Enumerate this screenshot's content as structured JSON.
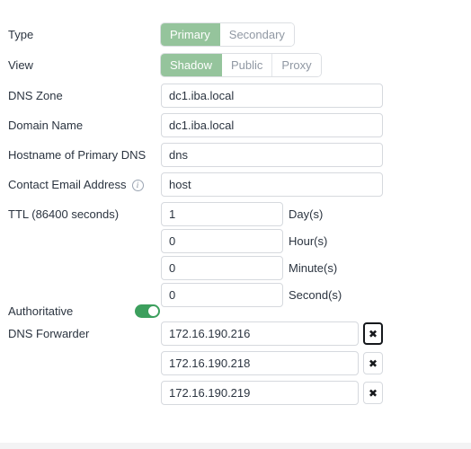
{
  "form": {
    "rows": {
      "type": {
        "label": "Type",
        "options": [
          "Primary",
          "Secondary"
        ],
        "selected": "Primary"
      },
      "view": {
        "label": "View",
        "options": [
          "Shadow",
          "Public",
          "Proxy"
        ],
        "selected": "Shadow"
      },
      "dns_zone": {
        "label": "DNS Zone",
        "value": "dc1.iba.local"
      },
      "domain_name": {
        "label": "Domain Name",
        "value": "dc1.iba.local"
      },
      "hostname_primary_dns": {
        "label": "Hostname of Primary DNS",
        "value": "dns"
      },
      "contact_email": {
        "label": "Contact Email Address",
        "value": "host",
        "info_icon": "info-icon"
      },
      "ttl": {
        "label": "TTL (86400 seconds)",
        "fields": [
          {
            "value": "1",
            "unit": "Day(s)"
          },
          {
            "value": "0",
            "unit": "Hour(s)"
          },
          {
            "value": "0",
            "unit": "Minute(s)"
          },
          {
            "value": "0",
            "unit": "Second(s)"
          }
        ]
      },
      "authoritative": {
        "label": "Authoritative",
        "state": "on"
      },
      "dns_forwarder": {
        "label": "DNS Forwarder",
        "remove_label": "✖",
        "entries": [
          {
            "value": "172.16.190.216",
            "focused": true
          },
          {
            "value": "172.16.190.218",
            "focused": false
          },
          {
            "value": "172.16.190.219",
            "focused": false
          }
        ]
      }
    }
  },
  "colors": {
    "accent_green": "#95c49c",
    "toggle_green": "#3c9f5d",
    "border": "#d6d9de",
    "text": "#2b3440",
    "muted_text": "#9098a3",
    "footer": "#f3f3f4"
  }
}
